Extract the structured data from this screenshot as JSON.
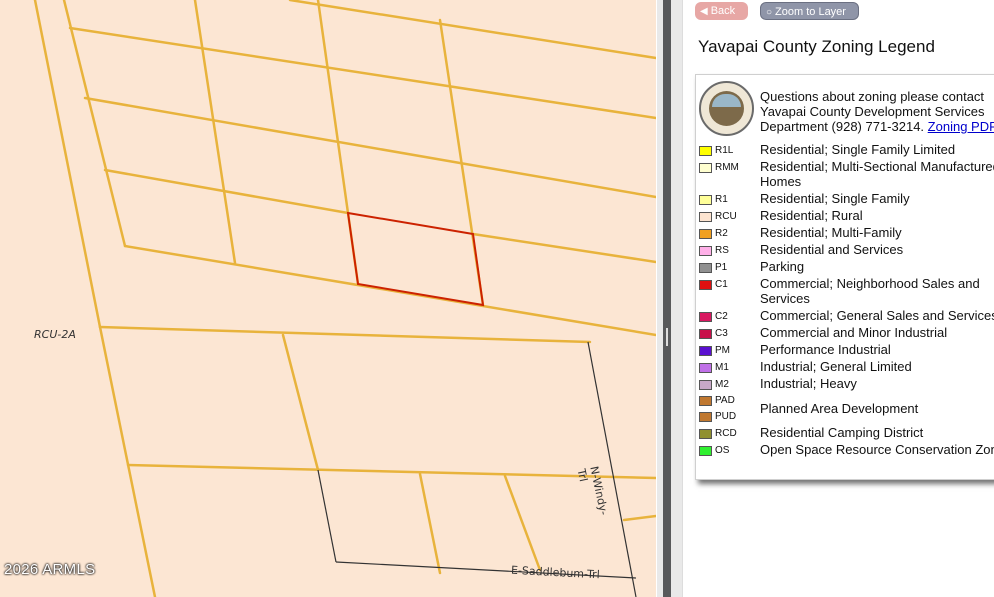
{
  "map": {
    "zone_label": "RCU-2A",
    "copyright": "2026 ARMLS",
    "streets": {
      "windy": "N-Windy-Trl",
      "saddlebum": "E-Saddlebum-Trl"
    },
    "colors": {
      "background": "#fce6d3",
      "parcel_line": "#e8b33c",
      "selected_parcel": "#cc2200",
      "street_line": "#333333"
    }
  },
  "panel": {
    "back_label": "Back",
    "zoom_label": "Zoom to Layer",
    "title": "Yavapai County Zoning Legend",
    "intro": {
      "line1": "Questions about zoning please contact",
      "line2": "Yavapai County Development Services",
      "line3_prefix": "Department (928) 771-3214.",
      "link": "Zoning PDF"
    },
    "legend": [
      {
        "code": "R1L",
        "color": "#ffff00",
        "desc": [
          "Residential; Single Family Limited"
        ]
      },
      {
        "code": "RMM",
        "color": "#ffffd0",
        "desc": [
          "Residential; Multi-Sectional Manufactured",
          "Homes"
        ]
      },
      {
        "code": "R1",
        "color": "#ffff99",
        "desc": [
          "Residential; Single Family"
        ]
      },
      {
        "code": "RCU",
        "color": "#fde4d0",
        "desc": [
          "Residential; Rural"
        ]
      },
      {
        "code": "R2",
        "color": "#f0a020",
        "desc": [
          "Residential; Multi-Family"
        ]
      },
      {
        "code": "RS",
        "color": "#ffb0e8",
        "desc": [
          "Residential and Services"
        ]
      },
      {
        "code": "P1",
        "color": "#909090",
        "desc": [
          "Parking"
        ]
      },
      {
        "code": "C1",
        "color": "#e01010",
        "desc": [
          "Commercial; Neighborhood Sales and",
          "Services"
        ]
      },
      {
        "code": "C2",
        "color": "#d81860",
        "desc": [
          "Commercial; General Sales and Services"
        ]
      },
      {
        "code": "C3",
        "color": "#c8104a",
        "desc": [
          "Commercial and Minor Industrial"
        ]
      },
      {
        "code": "PM",
        "color": "#5a10d0",
        "desc": [
          "Performance Industrial"
        ]
      },
      {
        "code": "M1",
        "color": "#c070e8",
        "desc": [
          "Industrial; General Limited"
        ]
      },
      {
        "code": "M2",
        "color": "#c8a8c8",
        "desc": [
          "Industrial; Heavy"
        ]
      },
      {
        "code": "PAD",
        "color": "#c07830",
        "desc": []
      },
      {
        "code": "PUD",
        "color": "#c07830",
        "desc": [
          "Planned Area Development"
        ]
      },
      {
        "code": "RCD",
        "color": "#909030",
        "desc": [
          "Residential Camping District"
        ]
      },
      {
        "code": "OS",
        "color": "#30f030",
        "desc": [
          "Open Space Resource Conservation Zone"
        ]
      }
    ]
  }
}
